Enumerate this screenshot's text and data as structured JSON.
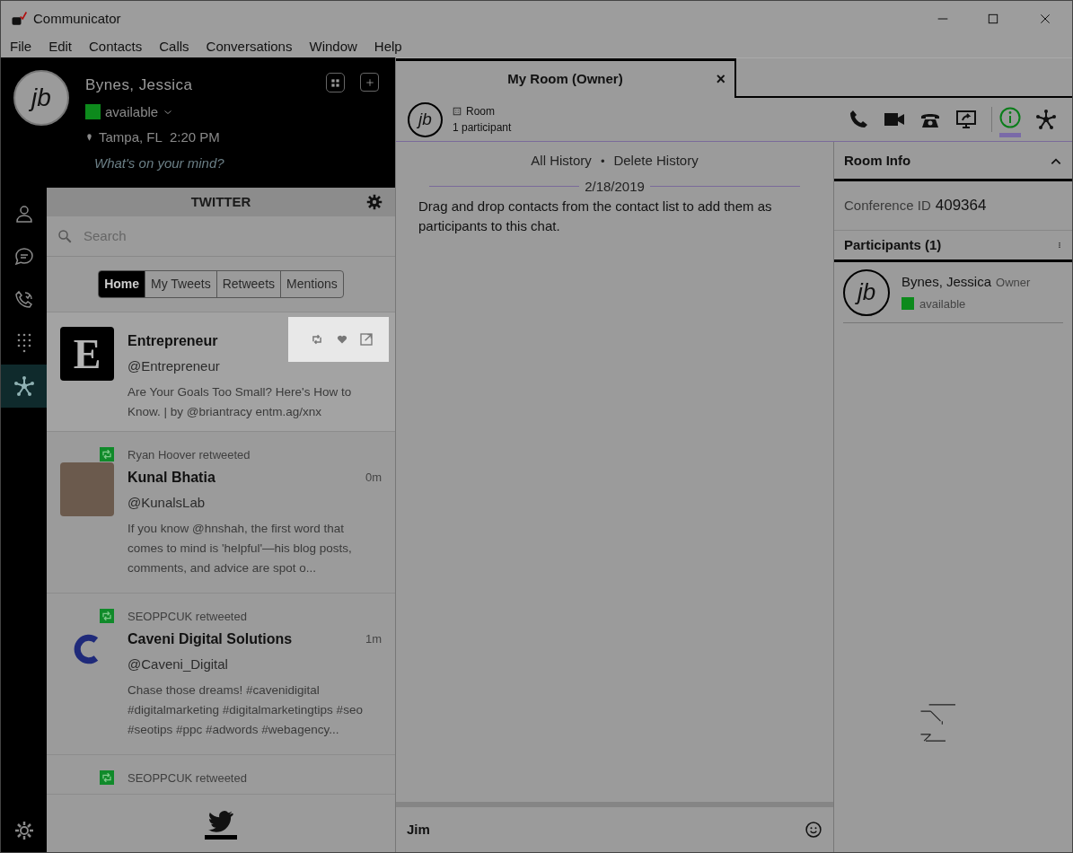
{
  "window": {
    "title": "Communicator"
  },
  "menu": [
    "File",
    "Edit",
    "Contacts",
    "Calls",
    "Conversations",
    "Window",
    "Help"
  ],
  "profile": {
    "initials": "jb",
    "name": "Bynes, Jessica",
    "status": "available",
    "color": "#0d8a1c",
    "location": "Tampa, FL",
    "time": "2:20 PM",
    "mood_placeholder": "What's on your mind?"
  },
  "nav": [
    {
      "kind": "contacts",
      "selected": false
    },
    {
      "kind": "chat",
      "selected": false
    },
    {
      "kind": "calls",
      "selected": false
    },
    {
      "kind": "dialpad",
      "selected": false
    },
    {
      "kind": "network",
      "selected": true
    }
  ],
  "twitter": {
    "title": "TWITTER",
    "search": {
      "placeholder": "Search"
    },
    "tabs": [
      {
        "label": "Home",
        "selected": true
      },
      {
        "label": "My Tweets",
        "selected": false
      },
      {
        "label": "Retweets",
        "selected": false
      },
      {
        "label": "Mentions",
        "selected": false
      }
    ],
    "tweets": [
      {
        "kind": "letter",
        "avatar_text": "E",
        "name": "Entrepreneur",
        "handle": "@Entrepreneur",
        "text": "Are Your Goals Too Small? Here's How to Know. | by @briantracy entm.ag/xnx",
        "hovered": true
      },
      {
        "retweeted_by": "Ryan Hoover retweeted",
        "kind": "photo",
        "name": "Kunal Bhatia",
        "handle": "@KunalsLab",
        "time": "0m",
        "text": "If you know @hnshah, the first word that comes to mind is 'helpful'—his blog posts, comments, and advice are spot o...",
        "hovered": false
      },
      {
        "retweeted_by": "SEOPPCUK retweeted",
        "kind": "logo",
        "name": "Caveni Digital Solutions",
        "handle": "@Caveni_Digital",
        "time": "1m",
        "text": "Chase those dreams! #cavenidigital #digitalmarketing #digitalmarketingtips #seo #seotips #ppc #adwords #webagency...",
        "hovered": false
      },
      {
        "retweeted_by": "SEOPPCUK retweeted",
        "kind": "photo",
        "partial": true,
        "hovered": false
      }
    ]
  },
  "conversation": {
    "tab": {
      "title": "My Room (Owner)",
      "close": "×"
    },
    "room": {
      "initials": "jb",
      "type": "Room",
      "participants": "1 participant"
    },
    "toolbar": [
      {
        "kind": "phone",
        "selected": false
      },
      {
        "kind": "video",
        "selected": false
      },
      {
        "kind": "deskphone",
        "selected": false
      },
      {
        "kind": "screen",
        "selected": false
      },
      {
        "kind": "info",
        "selected": true
      },
      {
        "kind": "network",
        "selected": false
      }
    ],
    "history_links": [
      "All History",
      "Delete History"
    ],
    "separator": "•",
    "date": "2/18/2019",
    "message": "Drag and drop contacts from the contact list to add them as participants to this chat.",
    "input": {
      "value": "Jim"
    }
  },
  "room_info": {
    "title": "Room Info",
    "conference_label": "Conference ID",
    "conference_id": "409364",
    "participants_title": "Participants (1)",
    "participants": [
      {
        "initials": "jb",
        "name": "Bynes, Jessica",
        "role": "Owner",
        "status": "available",
        "color": "#0d8a1c"
      }
    ]
  }
}
